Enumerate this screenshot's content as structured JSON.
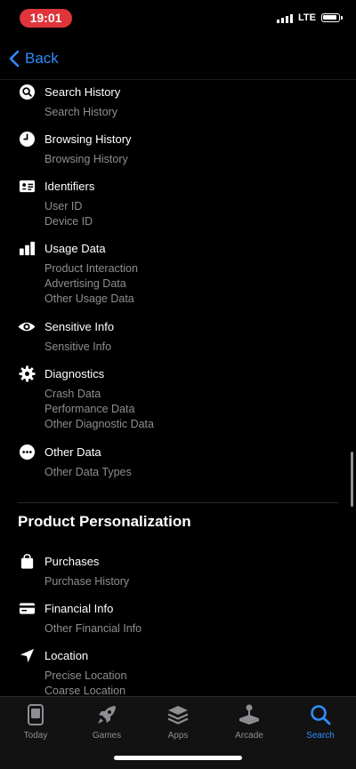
{
  "status_bar": {
    "time": "19:01",
    "network": "LTE"
  },
  "nav": {
    "back_label": "Back"
  },
  "items": [
    {
      "icon": "search-history-icon",
      "title": "Search History",
      "details": [
        "Search History"
      ]
    },
    {
      "icon": "clock-icon",
      "title": "Browsing History",
      "details": [
        "Browsing History"
      ]
    },
    {
      "icon": "id-card-icon",
      "title": "Identifiers",
      "details": [
        "User ID",
        "Device ID"
      ]
    },
    {
      "icon": "bar-chart-icon",
      "title": "Usage Data",
      "details": [
        "Product Interaction",
        "Advertising Data",
        "Other Usage Data"
      ]
    },
    {
      "icon": "eye-icon",
      "title": "Sensitive Info",
      "details": [
        "Sensitive Info"
      ]
    },
    {
      "icon": "gear-icon",
      "title": "Diagnostics",
      "details": [
        "Crash Data",
        "Performance Data",
        "Other Diagnostic Data"
      ]
    },
    {
      "icon": "ellipsis-circle-icon",
      "title": "Other Data",
      "details": [
        "Other Data Types"
      ]
    }
  ],
  "section": {
    "heading": "Product Personalization",
    "items": [
      {
        "icon": "shopping-bag-icon",
        "title": "Purchases",
        "details": [
          "Purchase History"
        ]
      },
      {
        "icon": "credit-card-icon",
        "title": "Financial Info",
        "details": [
          "Other Financial Info"
        ]
      },
      {
        "icon": "location-arrow-icon",
        "title": "Location",
        "details": [
          "Precise Location",
          "Coarse Location"
        ]
      }
    ]
  },
  "tabbar": {
    "tabs": [
      {
        "label": "Today",
        "icon": "today-icon"
      },
      {
        "label": "Games",
        "icon": "rocket-icon"
      },
      {
        "label": "Apps",
        "icon": "apps-stack-icon"
      },
      {
        "label": "Arcade",
        "icon": "joystick-icon"
      },
      {
        "label": "Search",
        "icon": "search-icon"
      }
    ],
    "active": "Search",
    "colors": {
      "active": "#2f8cff",
      "inactive": "#8e8e93"
    }
  }
}
